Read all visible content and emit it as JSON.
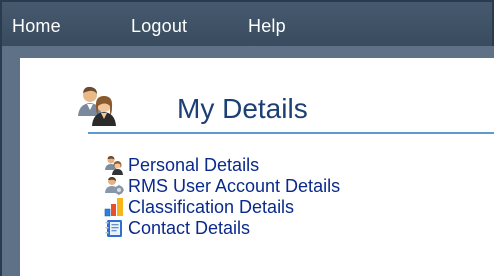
{
  "nav": {
    "items": [
      {
        "label": "Home"
      },
      {
        "label": "Logout"
      },
      {
        "label": "Help"
      }
    ]
  },
  "page": {
    "title": "My Details",
    "header_icon": "users-icon"
  },
  "links": [
    {
      "label": "Personal Details",
      "icon": "personal-details-icon"
    },
    {
      "label": "RMS User Account Details",
      "icon": "user-account-icon"
    },
    {
      "label": "Classification Details",
      "icon": "classification-icon"
    },
    {
      "label": "Contact Details",
      "icon": "contacts-book-icon"
    }
  ],
  "colors": {
    "nav_background": "#3e5165",
    "title_text": "#1c3f74",
    "link_text": "#0a2a8c",
    "rule": "#5c9ad0"
  }
}
